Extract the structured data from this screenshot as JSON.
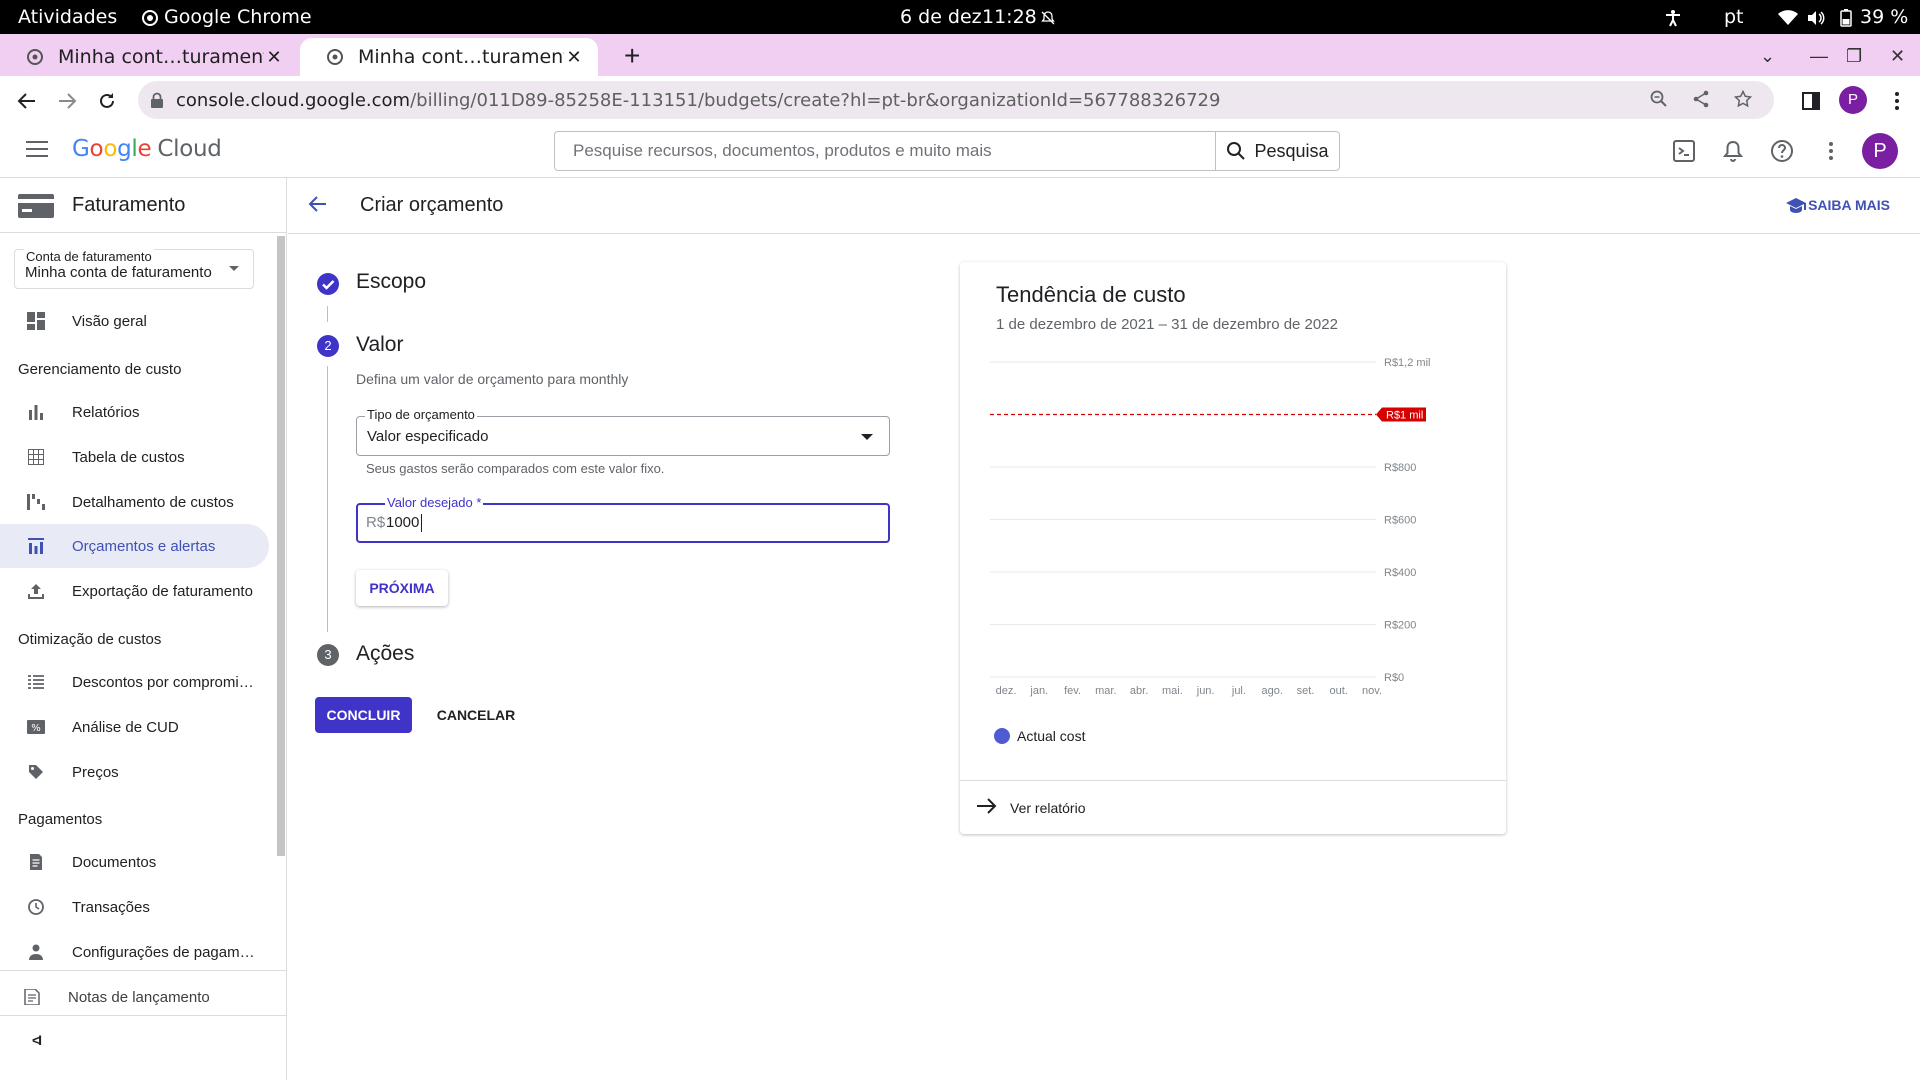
{
  "os": {
    "activities": "Atividades",
    "app": "Google Chrome",
    "date": "6 de dez",
    "time": "11:28",
    "lang": "pt",
    "battery": "39 %"
  },
  "browser": {
    "tabs": [
      {
        "title": "Minha cont…turamento –",
        "active": false
      },
      {
        "title": "Minha cont…turamento –",
        "active": true
      }
    ],
    "url_host": "console.cloud.google.com",
    "url_path": "/billing/011D89-85258E-113151/budgets/create?hl=pt-br&organizationId=567788326729",
    "profile_letter": "P"
  },
  "header": {
    "logo": "Google",
    "logo_suffix": "Cloud",
    "search_placeholder": "Pesquise recursos, documentos, produtos e muito mais",
    "search_button": "Pesquisa",
    "avatar_letter": "P"
  },
  "sidebar": {
    "title": "Faturamento",
    "account_label": "Conta de faturamento",
    "account_value": "Minha conta de faturamento",
    "overview": "Visão geral",
    "section_cost": "Gerenciamento de custo",
    "reports": "Relatórios",
    "cost_table": "Tabela de custos",
    "cost_breakdown": "Detalhamento de custos",
    "budgets": "Orçamentos e alertas",
    "export": "Exportação de faturamento",
    "section_opt": "Otimização de custos",
    "commit": "Descontos por compromi…",
    "cud": "Análise de CUD",
    "pricing": "Preços",
    "section_pay": "Pagamentos",
    "documents": "Documentos",
    "transactions": "Transações",
    "payment_settings": "Configurações de pagam…",
    "release_notes": "Notas de lançamento",
    "collapse": "<I"
  },
  "page": {
    "title": "Criar orçamento",
    "learn_more": "SAIBA MAIS"
  },
  "stepper": {
    "step1": "Escopo",
    "step2_num": "2",
    "step2": "Valor",
    "step2_desc": "Defina um valor de orçamento para monthly",
    "type_label": "Tipo de orçamento",
    "type_value": "Valor especificado",
    "type_hint": "Seus gastos serão comparados com este valor fixo.",
    "amount_label": "Valor desejado *",
    "amount_prefix": "R$",
    "amount_value": "1000",
    "next": "PRÓXIMA",
    "step3_num": "3",
    "step3": "Ações",
    "done": "CONCLUIR",
    "cancel": "CANCELAR"
  },
  "card": {
    "title": "Tendência de custo",
    "subtitle": "1 de dezembro de 2021 – 31 de dezembro de 2022",
    "legend": "Actual cost",
    "link": "Ver relatório"
  },
  "chart_data": {
    "type": "line",
    "categories": [
      "dez.",
      "jan.",
      "fev.",
      "mar.",
      "abr.",
      "mai.",
      "jun.",
      "jul.",
      "ago.",
      "set.",
      "out.",
      "nov."
    ],
    "series": [
      {
        "name": "Actual cost",
        "values": [
          0,
          0,
          0,
          0,
          0,
          0,
          0,
          0,
          0,
          0,
          0,
          0
        ]
      }
    ],
    "y_ticks": [
      "R$0",
      "R$200",
      "R$400",
      "R$600",
      "R$800",
      "R$1 mil",
      "R$1,2 mil"
    ],
    "y_tick_values": [
      0,
      200,
      400,
      600,
      800,
      1000,
      1200
    ],
    "ylim": [
      0,
      1200
    ],
    "budget_line": {
      "value": 1000,
      "label": "R$1 mil",
      "color": "#d50000"
    },
    "grid": true,
    "legend_position": "bottom-left",
    "series_color": "#4f5bd5"
  },
  "colors": {
    "accent": "#3f33c8",
    "link": "#3f51b5",
    "sidebar_active_bg": "#e8eaf6",
    "tab_strip": "#f1cff3"
  }
}
